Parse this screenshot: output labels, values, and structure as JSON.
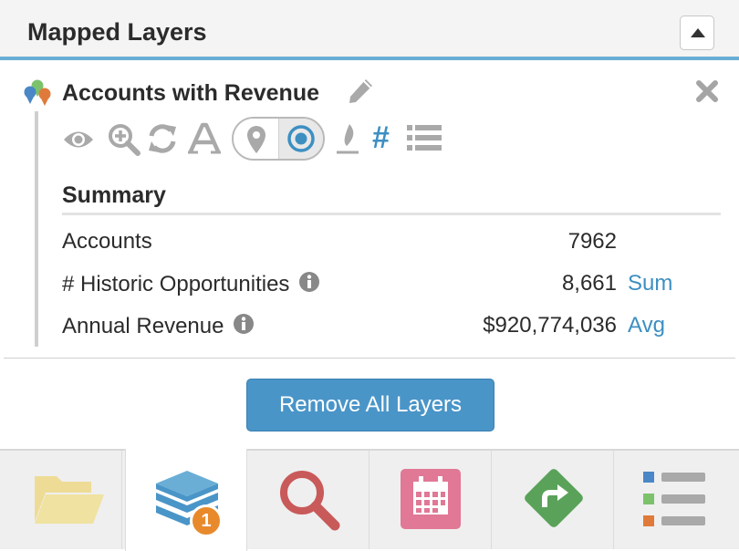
{
  "header": {
    "title": "Mapped Layers",
    "collapse_icon": "caret-up-icon"
  },
  "layer": {
    "title": "Accounts with Revenue",
    "marker_icon": "map-markers-icon",
    "edit_icon": "pencil-icon",
    "remove_icon": "close-icon",
    "toolbar_icons": [
      "eye-icon",
      "zoom-in-icon",
      "refresh-icon",
      "font-icon",
      "map-pin-icon",
      "target-icon",
      "fire-icon",
      "hash-icon",
      "list-icon"
    ],
    "summary": {
      "heading": "Summary",
      "rows": [
        {
          "label": "Accounts",
          "value": "7962",
          "aggregate": ""
        },
        {
          "label": "# Historic Opportunities",
          "value": "8,661",
          "aggregate": "Sum"
        },
        {
          "label": "Annual Revenue",
          "value": "$920,774,036",
          "aggregate": "Avg"
        }
      ]
    }
  },
  "actions": {
    "remove_all_label": "Remove All Layers"
  },
  "tabs": {
    "items": [
      "folder-icon",
      "layers-icon",
      "search-icon",
      "calendar-icon",
      "directions-icon",
      "legend-list-icon"
    ],
    "active_index": 1,
    "layers_badge": "1"
  },
  "colors": {
    "accent": "#4a95c8",
    "header_rule": "#6aaed6",
    "link": "#3d8fc2",
    "badge": "#e88a2c",
    "icon_gray": "#a9a9a9"
  }
}
